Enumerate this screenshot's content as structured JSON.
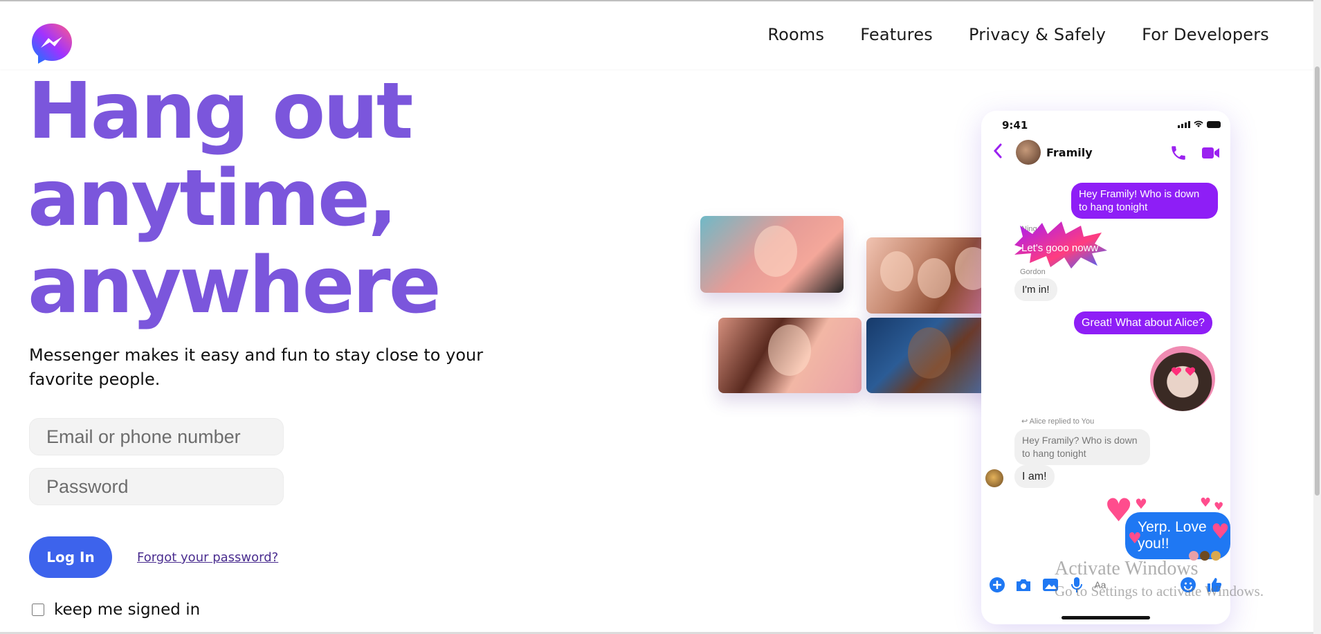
{
  "header": {
    "logo": "messenger-logo",
    "nav": [
      "Rooms",
      "Features",
      "Privacy & Safely",
      "For Developers"
    ]
  },
  "hero": {
    "title_lines": [
      "Hang out",
      "anytime,",
      "anywhere"
    ],
    "description": "Messenger makes it easy and fun to stay close to your favorite people."
  },
  "form": {
    "email_placeholder": "Email or phone number",
    "password_placeholder": "Password",
    "login_label": "Log In",
    "forgot_label": "Forgot your password?",
    "keep_signed_in": "keep me signed in",
    "keep_signed_in_checked": false
  },
  "phone": {
    "time": "9:41",
    "chat_name": "Framily",
    "messages": [
      {
        "text": "Hey Framily! Who is down to hang tonight"
      },
      {
        "sender": "Ning",
        "text": "Let's gooo noww"
      },
      {
        "sender": "Gordon",
        "text": "I'm in!"
      },
      {
        "text": "Great! What about Alice?"
      },
      {
        "reply_label": "Alice replied to You",
        "quoted": "Hey Framily? Who is down to hang tonight",
        "text": "I am!"
      },
      {
        "text": "Yerp. Love you!!"
      }
    ],
    "composer_placeholder": "Aa"
  },
  "watermark": {
    "title": "Activate Windows",
    "subtitle": "Go to Settings to activate Windows."
  },
  "colors": {
    "hero": "#7b56dc",
    "login_button": "#3d63ec",
    "outgoing_bubble": "#8e1ef6",
    "love_bubble": "#1f78f3"
  }
}
